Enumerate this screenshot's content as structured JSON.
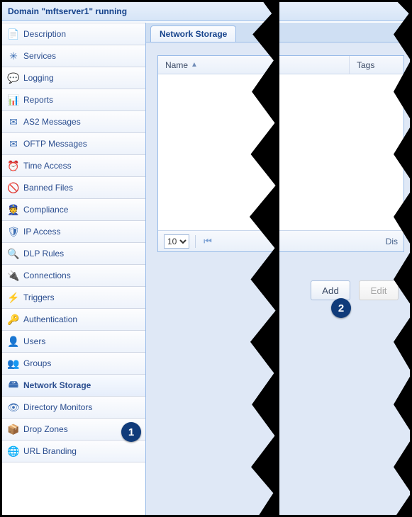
{
  "header": {
    "title": "Domain \"mftserver1\" running"
  },
  "sidebar": {
    "items": [
      {
        "label": "Description",
        "icon": "📄",
        "iconName": "description-icon"
      },
      {
        "label": "Services",
        "icon": "✳",
        "iconName": "services-icon"
      },
      {
        "label": "Logging",
        "icon": "💬",
        "iconName": "logging-icon"
      },
      {
        "label": "Reports",
        "icon": "📊",
        "iconName": "reports-icon"
      },
      {
        "label": "AS2 Messages",
        "icon": "✉",
        "iconName": "as2-messages-icon"
      },
      {
        "label": "OFTP Messages",
        "icon": "✉",
        "iconName": "oftp-messages-icon"
      },
      {
        "label": "Time Access",
        "icon": "⏰",
        "iconName": "time-access-icon"
      },
      {
        "label": "Banned Files",
        "icon": "🚫",
        "iconName": "banned-files-icon"
      },
      {
        "label": "Compliance",
        "icon": "👮",
        "iconName": "compliance-icon"
      },
      {
        "label": "IP Access",
        "icon": "🛡",
        "iconName": "ip-access-icon"
      },
      {
        "label": "DLP Rules",
        "icon": "🔍",
        "iconName": "dlp-rules-icon"
      },
      {
        "label": "Connections",
        "icon": "🔌",
        "iconName": "connections-icon"
      },
      {
        "label": "Triggers",
        "icon": "⚡",
        "iconName": "triggers-icon"
      },
      {
        "label": "Authentication",
        "icon": "🔑",
        "iconName": "authentication-icon"
      },
      {
        "label": "Users",
        "icon": "👤",
        "iconName": "users-icon"
      },
      {
        "label": "Groups",
        "icon": "👥",
        "iconName": "groups-icon"
      },
      {
        "label": "Network Storage",
        "icon": "🖴",
        "iconName": "network-storage-icon",
        "active": true
      },
      {
        "label": "Directory Monitors",
        "icon": "👁",
        "iconName": "directory-monitors-icon"
      },
      {
        "label": "Drop Zones",
        "icon": "📦",
        "iconName": "drop-zones-icon"
      },
      {
        "label": "URL Branding",
        "icon": "🌐",
        "iconName": "url-branding-icon"
      }
    ]
  },
  "main": {
    "tab_label": "Network Storage",
    "grid": {
      "columns": {
        "name": "Name",
        "tags": "Tags"
      },
      "sort": {
        "column": "name",
        "dir": "asc"
      },
      "page_size_options": [
        "10"
      ],
      "page_size_value": "10",
      "status_prefix": "Dis"
    },
    "actions": {
      "add": "Add",
      "edit": "Edit"
    }
  },
  "callouts": {
    "one": "1",
    "two": "2"
  }
}
